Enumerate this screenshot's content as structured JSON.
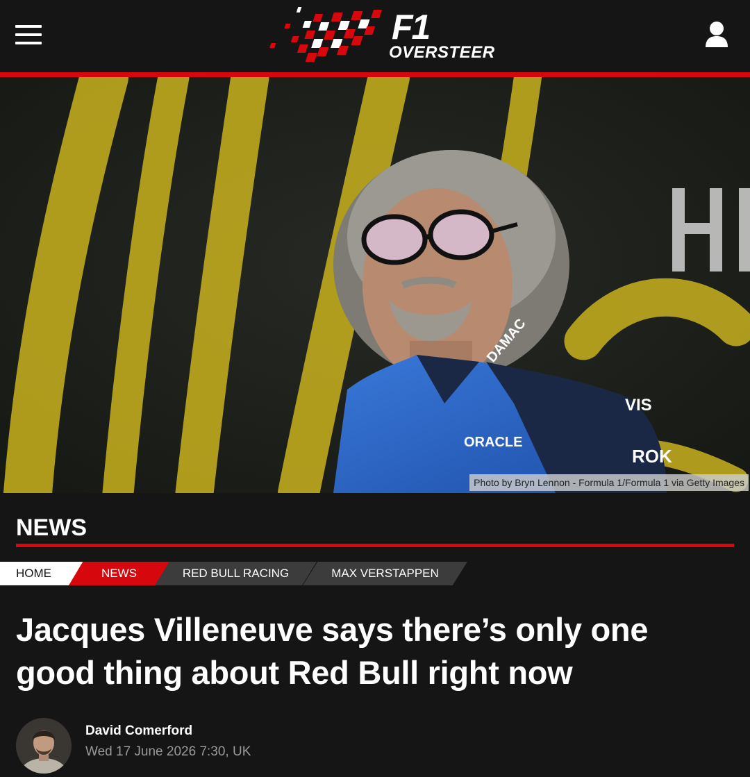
{
  "header": {
    "logo_mark": "F1",
    "logo_sub": "OVERSTEER",
    "menu_icon": "hamburger-menu-icon",
    "user_icon": "user-account-icon",
    "accent_color": "#d7070e"
  },
  "hero": {
    "photo_caption": "Photo by Bryn Lennon - Formula 1/Formula 1 via Getty Images"
  },
  "section": {
    "title": "NEWS"
  },
  "breadcrumbs": [
    {
      "label": "HOME"
    },
    {
      "label": "NEWS"
    },
    {
      "label": "RED BULL RACING"
    },
    {
      "label": "MAX VERSTAPPEN"
    }
  ],
  "article": {
    "headline": "Jacques Villeneuve says there’s only one good thing about Red Bull right now",
    "author": "David Comerford",
    "published": "Wed 17 June 2026 7:30, UK"
  }
}
